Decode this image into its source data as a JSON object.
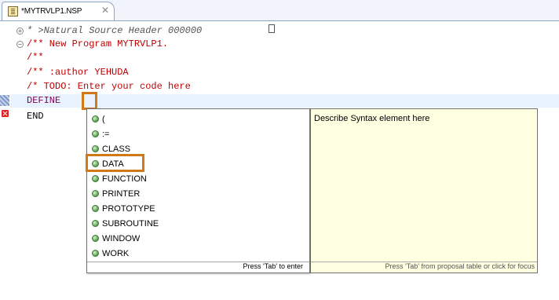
{
  "editor_tab": {
    "title": "*MYTRVLP1.NSP",
    "close_icon": "close-icon"
  },
  "code": {
    "header": "* >Natural Source Header 000000",
    "new_program": "/** New Program MYTRVLP1.",
    "doc_open": "/**",
    "author": "/** :author YEHUDA",
    "todo": "/* TODO: Enter your code here",
    "define": "DEFINE",
    "end": "END"
  },
  "completion": {
    "items": [
      "(",
      ":=",
      "CLASS",
      "DATA",
      "FUNCTION",
      "PRINTER",
      "PROTOTYPE",
      "SUBROUTINE",
      "WINDOW",
      "WORK"
    ],
    "status": "Press 'Tab' to enter"
  },
  "info_panel": {
    "description": "Describe Syntax element here",
    "footer": "Press 'Tab' from proposal table or click for focus"
  },
  "colors": {
    "highlight": "#d07a17",
    "comment": "#c00000",
    "keyword": "#7f0055",
    "info_bg": "#ffffe1"
  }
}
